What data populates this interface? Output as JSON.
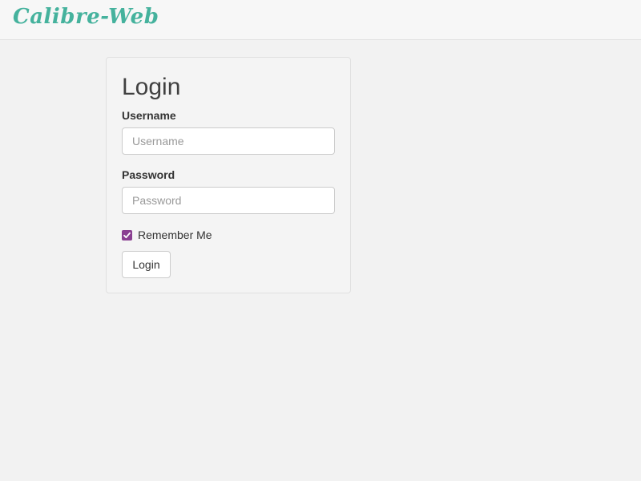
{
  "header": {
    "brand": "Calibre-Web"
  },
  "login": {
    "title": "Login",
    "username_label": "Username",
    "username_placeholder": "Username",
    "username_value": "",
    "password_label": "Password",
    "password_placeholder": "Password",
    "password_value": "",
    "remember_label": "Remember Me",
    "remember_checked": true,
    "submit_label": "Login"
  },
  "colors": {
    "brand": "#45b29d",
    "checkbox_accent": "#8a3f91",
    "background": "#f2f2f2"
  },
  "icons": {
    "checkbox": "check-icon"
  }
}
